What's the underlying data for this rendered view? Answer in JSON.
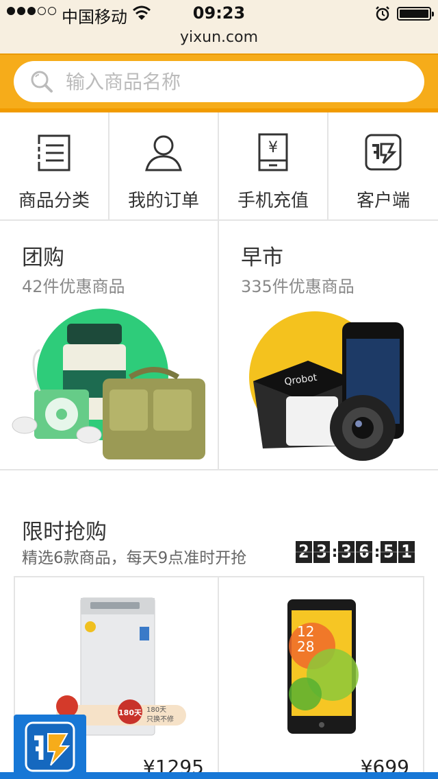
{
  "status_bar": {
    "carrier": "中国移动",
    "time": "09:23",
    "signal_filled": 3,
    "signal_total": 5,
    "battery_level": 1.0
  },
  "browser": {
    "url": "yixun.com"
  },
  "search": {
    "placeholder": "输入商品名称"
  },
  "quick_nav": [
    {
      "label": "商品分类",
      "icon": "list-icon"
    },
    {
      "label": "我的订单",
      "icon": "person-icon"
    },
    {
      "label": "手机充值",
      "icon": "yuan-phone-icon"
    },
    {
      "label": "客户端",
      "icon": "yixun-app-icon"
    }
  ],
  "promos": [
    {
      "title": "团购",
      "subtitle": "42件优惠商品",
      "accent": "#2ecc7a"
    },
    {
      "title": "早市",
      "subtitle": "335件优惠商品",
      "accent": "#f4c21e"
    }
  ],
  "flash_sale": {
    "title": "限时抢购",
    "subtitle": "精选6款商品，每天9点准时开抢",
    "countdown": {
      "hours": "23",
      "minutes": "36",
      "seconds": "51"
    },
    "products": [
      {
        "price": "¥1295",
        "badge_text": "180天",
        "tag_line1": "180天",
        "tag_line2": "只换不修"
      },
      {
        "price": "¥699"
      }
    ]
  },
  "colors": {
    "search_bar_bg": "#f6ac1a",
    "status_bg": "#f7efe0",
    "app_badge": "#1777d6"
  }
}
